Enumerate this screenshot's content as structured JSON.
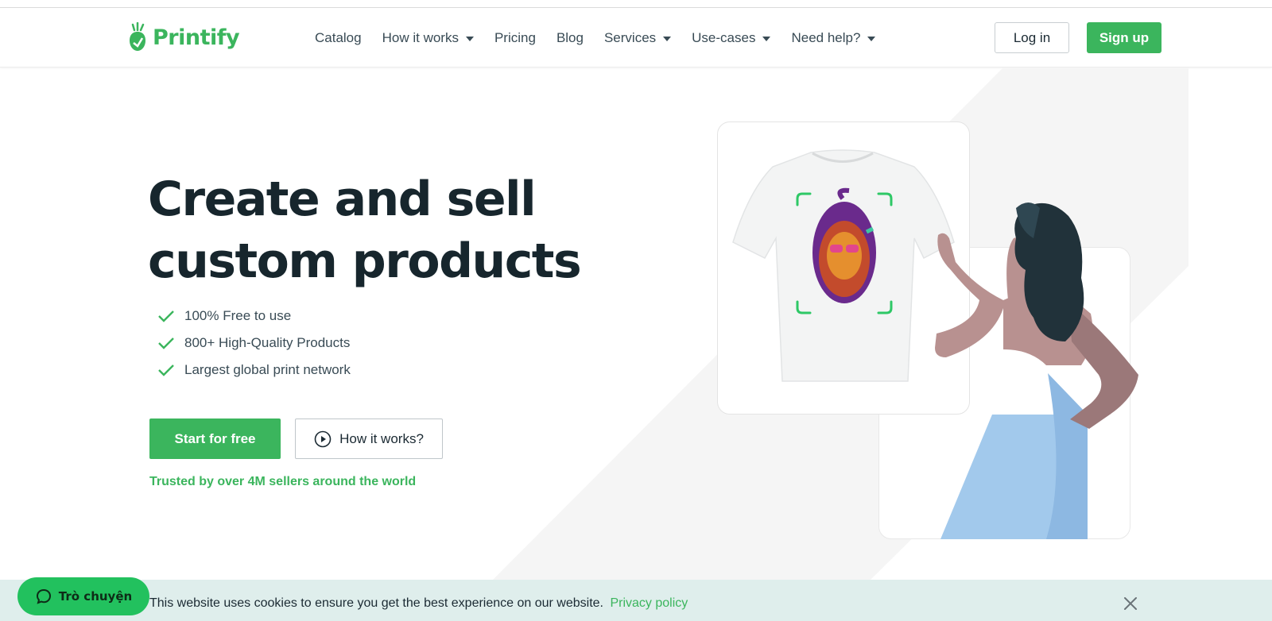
{
  "brand": {
    "name": "Printify",
    "color": "#3bb55d"
  },
  "nav": {
    "items": [
      {
        "label": "Catalog",
        "has_dropdown": false
      },
      {
        "label": "How it works",
        "has_dropdown": true
      },
      {
        "label": "Pricing",
        "has_dropdown": false
      },
      {
        "label": "Blog",
        "has_dropdown": false
      },
      {
        "label": "Services",
        "has_dropdown": true
      },
      {
        "label": "Use-cases",
        "has_dropdown": true
      },
      {
        "label": "Need help?",
        "has_dropdown": true
      }
    ],
    "login_label": "Log in",
    "signup_label": "Sign up"
  },
  "hero": {
    "headline_line1": "Create and sell",
    "headline_line2": "custom products",
    "features": [
      "100% Free to use",
      "800+ High-Quality Products",
      "Largest global print network"
    ],
    "start_label": "Start for free",
    "how_label": "How it works?",
    "trusted_text": "Trusted by over 4M sellers around the world"
  },
  "cookie": {
    "text": "This website uses cookies to ensure you get the best experience on our website.",
    "link_label": "Privacy policy"
  },
  "chat": {
    "label": "Trò chuyện"
  },
  "colors": {
    "accent": "#3bb55d",
    "dark_text": "#17262d",
    "cookie_bg": "#dfeeec",
    "chat_bg": "#22c15e"
  }
}
